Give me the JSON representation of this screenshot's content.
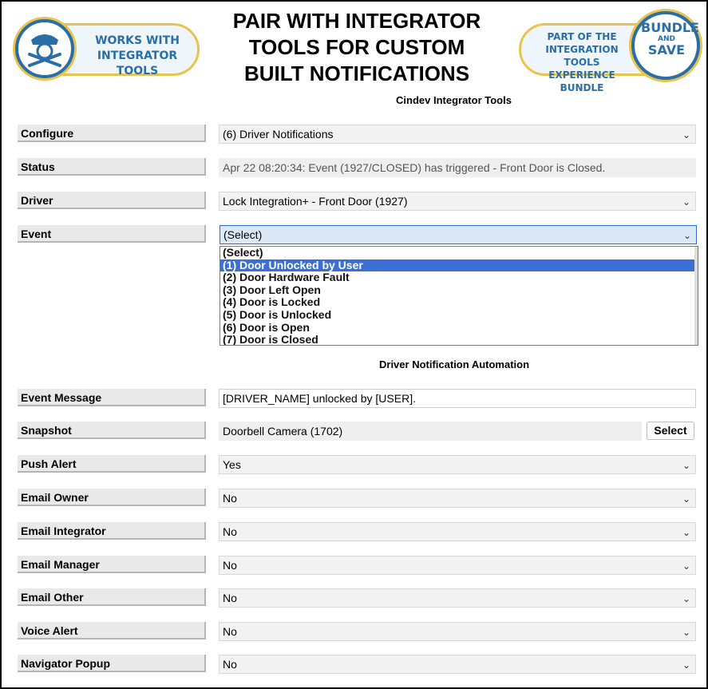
{
  "banner": {
    "headline_lines": [
      "PAIR WITH INTEGRATOR",
      "TOOLS FOR CUSTOM",
      "BUILT NOTIFICATIONS"
    ],
    "left_badge_lines": [
      "WORKS WITH",
      "INTEGRATOR TOOLS"
    ],
    "right_badge_lines": [
      "PART OF THE",
      "INTEGRATION TOOLS",
      "EXPERIENCE BUNDLE"
    ],
    "bundle_lines": [
      "BUNDLE",
      "AND",
      "SAVE"
    ],
    "accent_color": "#2a6ea8",
    "gold_color": "#e8c44a"
  },
  "app_title": "Cindev Integrator Tools",
  "top_form": {
    "configure": {
      "label": "Configure",
      "value": "(6) Driver Notifications"
    },
    "status": {
      "label": "Status",
      "value": "Apr 22 08:20:34: Event (1927/CLOSED) has triggered - Front Door is Closed."
    },
    "driver": {
      "label": "Driver",
      "value": "Lock Integration+ - Front Door (1927)"
    },
    "event": {
      "label": "Event",
      "value": "(Select)"
    }
  },
  "event_options": [
    "(Select)",
    "(1) Door Unlocked by User",
    "(2) Door Hardware Fault",
    "(3) Door Left Open",
    "(4) Door is Locked",
    "(5) Door is Unlocked",
    "(6) Door is Open",
    "(7) Door is Closed"
  ],
  "highlighted_option_index": 1,
  "automation_title": "Driver Notification Automation",
  "automation": {
    "event_message": {
      "label": "Event Message",
      "value": "[DRIVER_NAME] unlocked by [USER]."
    },
    "snapshot": {
      "label": "Snapshot",
      "value": "Doorbell Camera (1702)",
      "button": "Select"
    },
    "push_alert": {
      "label": "Push Alert",
      "value": "Yes"
    },
    "email_owner": {
      "label": "Email Owner",
      "value": "No"
    },
    "email_integrator": {
      "label": "Email Integrator",
      "value": "No"
    },
    "email_manager": {
      "label": "Email Manager",
      "value": "No"
    },
    "email_other": {
      "label": "Email Other",
      "value": "No"
    },
    "voice_alert": {
      "label": "Voice Alert",
      "value": "No"
    },
    "navigator_popup": {
      "label": "Navigator Popup",
      "value": "No"
    }
  }
}
